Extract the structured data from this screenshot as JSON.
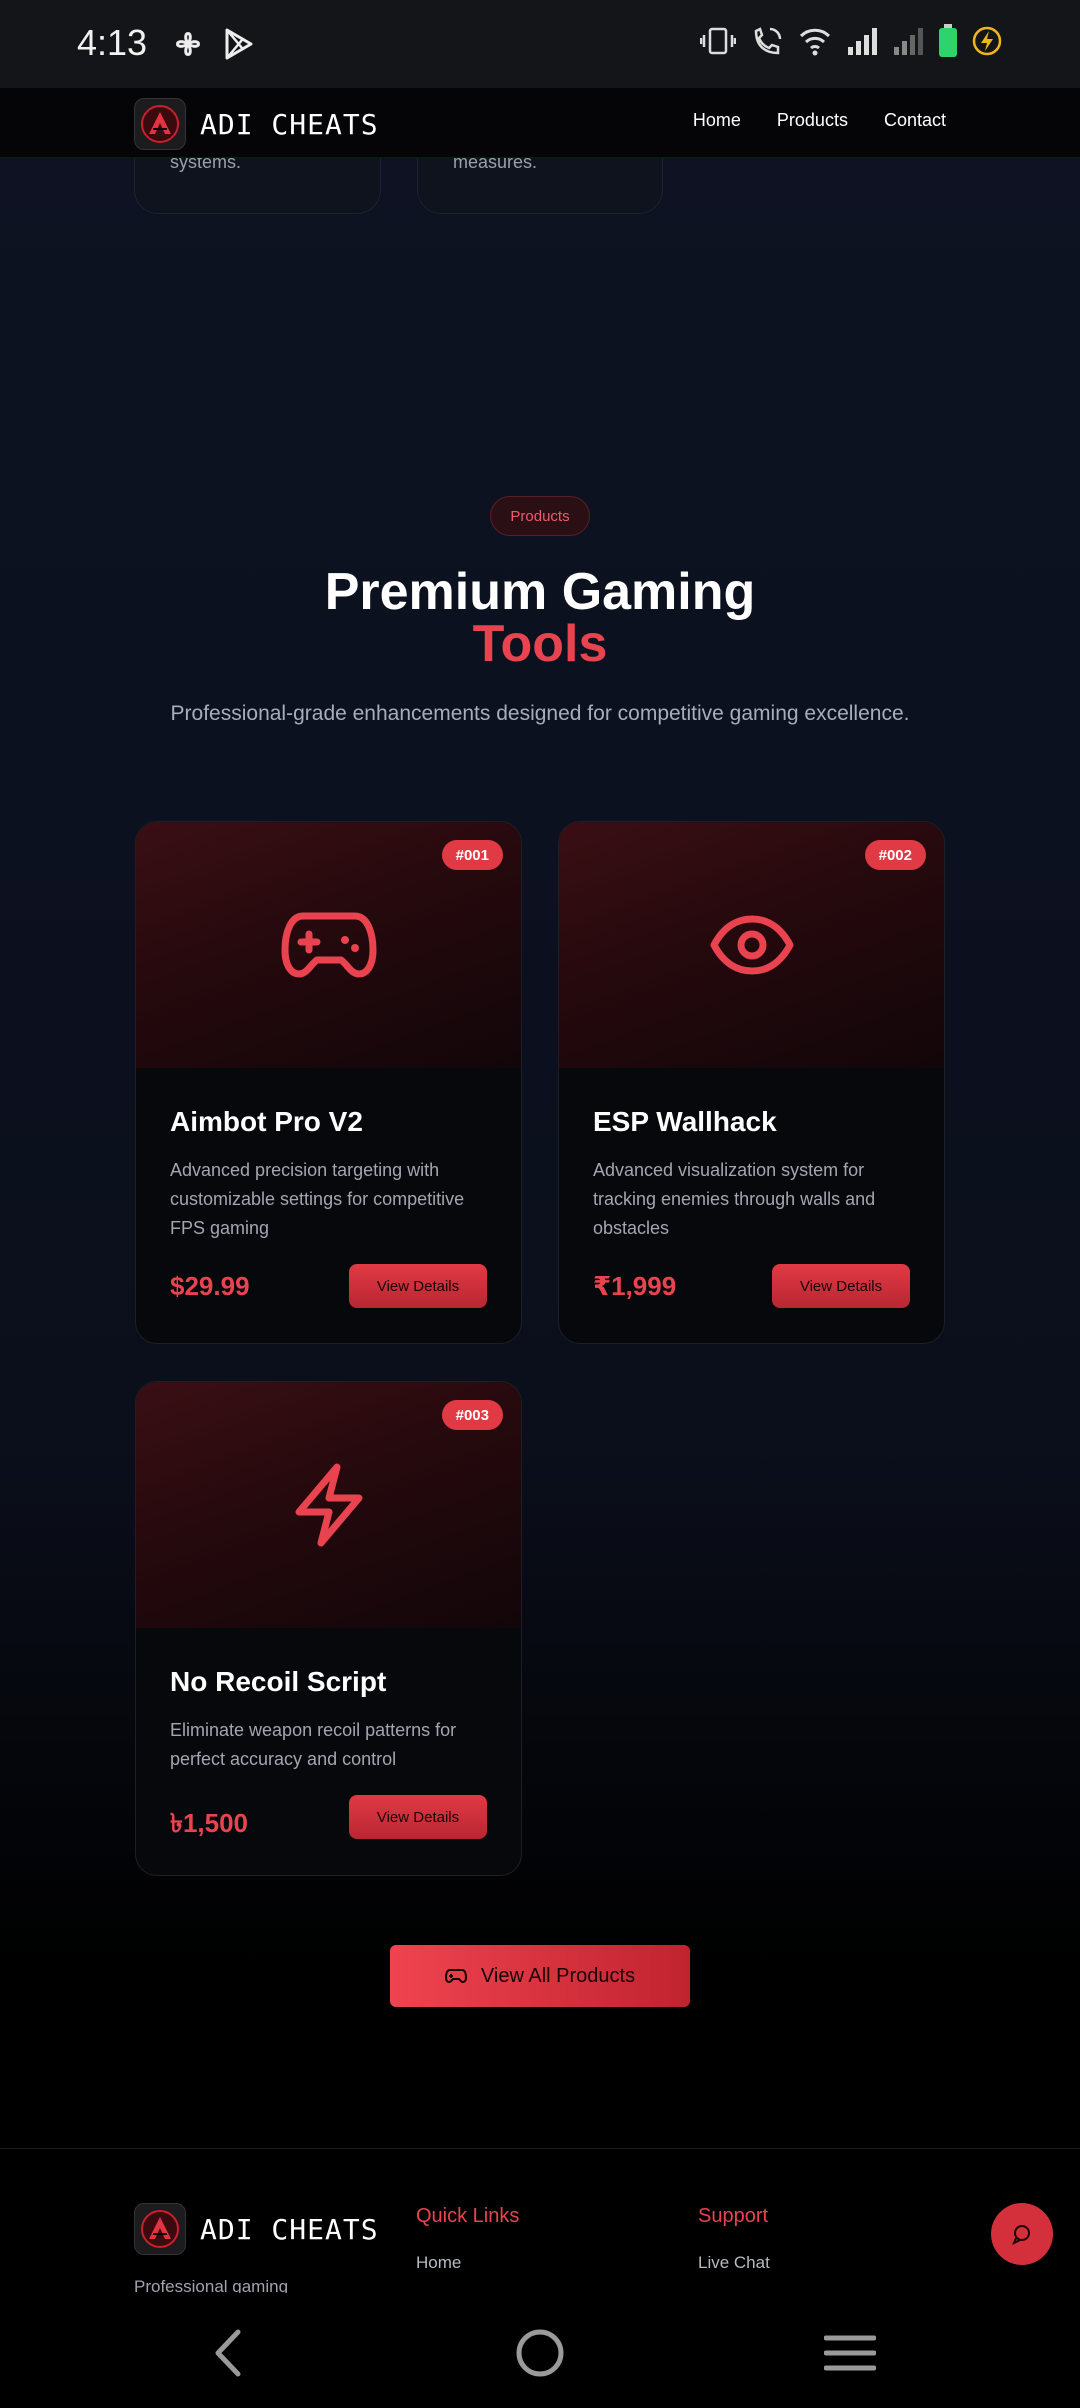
{
  "status_bar": {
    "time": "4:13"
  },
  "navbar": {
    "brand": "ADI CHEATS",
    "links": [
      "Home",
      "Products",
      "Contact"
    ]
  },
  "previous_cards": [
    {
      "text": "systems."
    },
    {
      "text": "measures."
    }
  ],
  "section": {
    "pill": "Products",
    "title_line1": "Premium Gaming",
    "title_line2": "Tools",
    "subtitle": "Professional-grade enhancements designed for competitive gaming excellence."
  },
  "products": [
    {
      "num": "#001",
      "icon": "gamepad-icon",
      "title": "Aimbot Pro V2",
      "desc": "Advanced precision targeting with customizable settings for competitive FPS gaming",
      "price": "$29.99",
      "button": "View Details"
    },
    {
      "num": "#002",
      "icon": "eye-icon",
      "title": "ESP Wallhack",
      "desc": "Advanced visualization system for tracking enemies through walls and obstacles",
      "price": "₹1,999",
      "button": "View Details"
    },
    {
      "num": "#003",
      "icon": "lightning-icon",
      "title": "No Recoil Script",
      "desc": "Eliminate weapon recoil patterns for perfect accuracy and control",
      "price": "৳1,500",
      "button": "View Details"
    }
  ],
  "view_all_label": "View All Products",
  "footer": {
    "brand": "ADI CHEATS",
    "tagline": "Professional gaming",
    "quick_links_heading": "Quick Links",
    "quick_links_first": "Home",
    "support_heading": "Support",
    "support_first": "Live Chat"
  },
  "colors": {
    "accent": "#e8434e",
    "background": "#0b0f1b"
  }
}
